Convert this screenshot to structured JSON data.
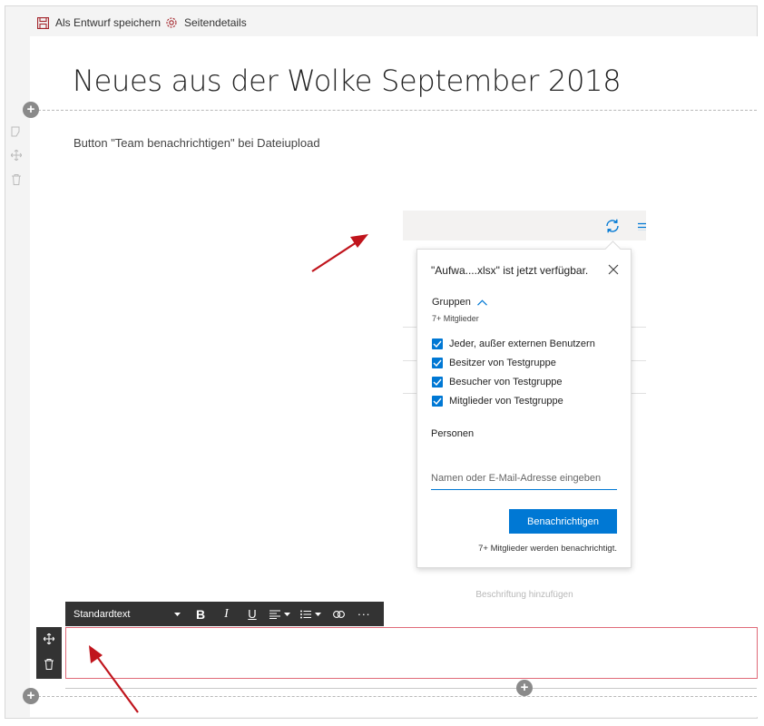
{
  "command_bar": {
    "save_draft_label": "Als Entwurf speichern",
    "page_details_label": "Seitendetails"
  },
  "page": {
    "title": "Neues aus der Wolke September 2018",
    "body_text": "Button \"Team benachrichtigen\" bei Dateiupload"
  },
  "popup": {
    "title": "\"Aufwa....xlsx\" ist jetzt verfügbar.",
    "groups_label": "Gruppen",
    "groups_count": "7+ Mitglieder",
    "groups": [
      {
        "label": "Jeder, außer externen Benutzern",
        "checked": true
      },
      {
        "label": "Besitzer von Testgruppe",
        "checked": true
      },
      {
        "label": "Besucher von Testgruppe",
        "checked": true
      },
      {
        "label": "Mitglieder von Testgruppe",
        "checked": true
      }
    ],
    "persons_label": "Personen",
    "persons_placeholder": "Namen oder E-Mail-Adresse eingeben",
    "notify_button": "Benachrichtigen",
    "footer": "7+ Mitglieder werden benachrichtigt."
  },
  "image_caption_placeholder": "Beschriftung hinzufügen",
  "toolbar": {
    "style_selected": "Standardtext",
    "bold_label": "B",
    "italic_label": "I",
    "underline_label": "U",
    "more_label": "···"
  },
  "colors": {
    "accent": "#0078d4",
    "toolbar_bg": "#333333",
    "annotation_arrow": "#c0141c",
    "editor_border": "#e06a78"
  }
}
